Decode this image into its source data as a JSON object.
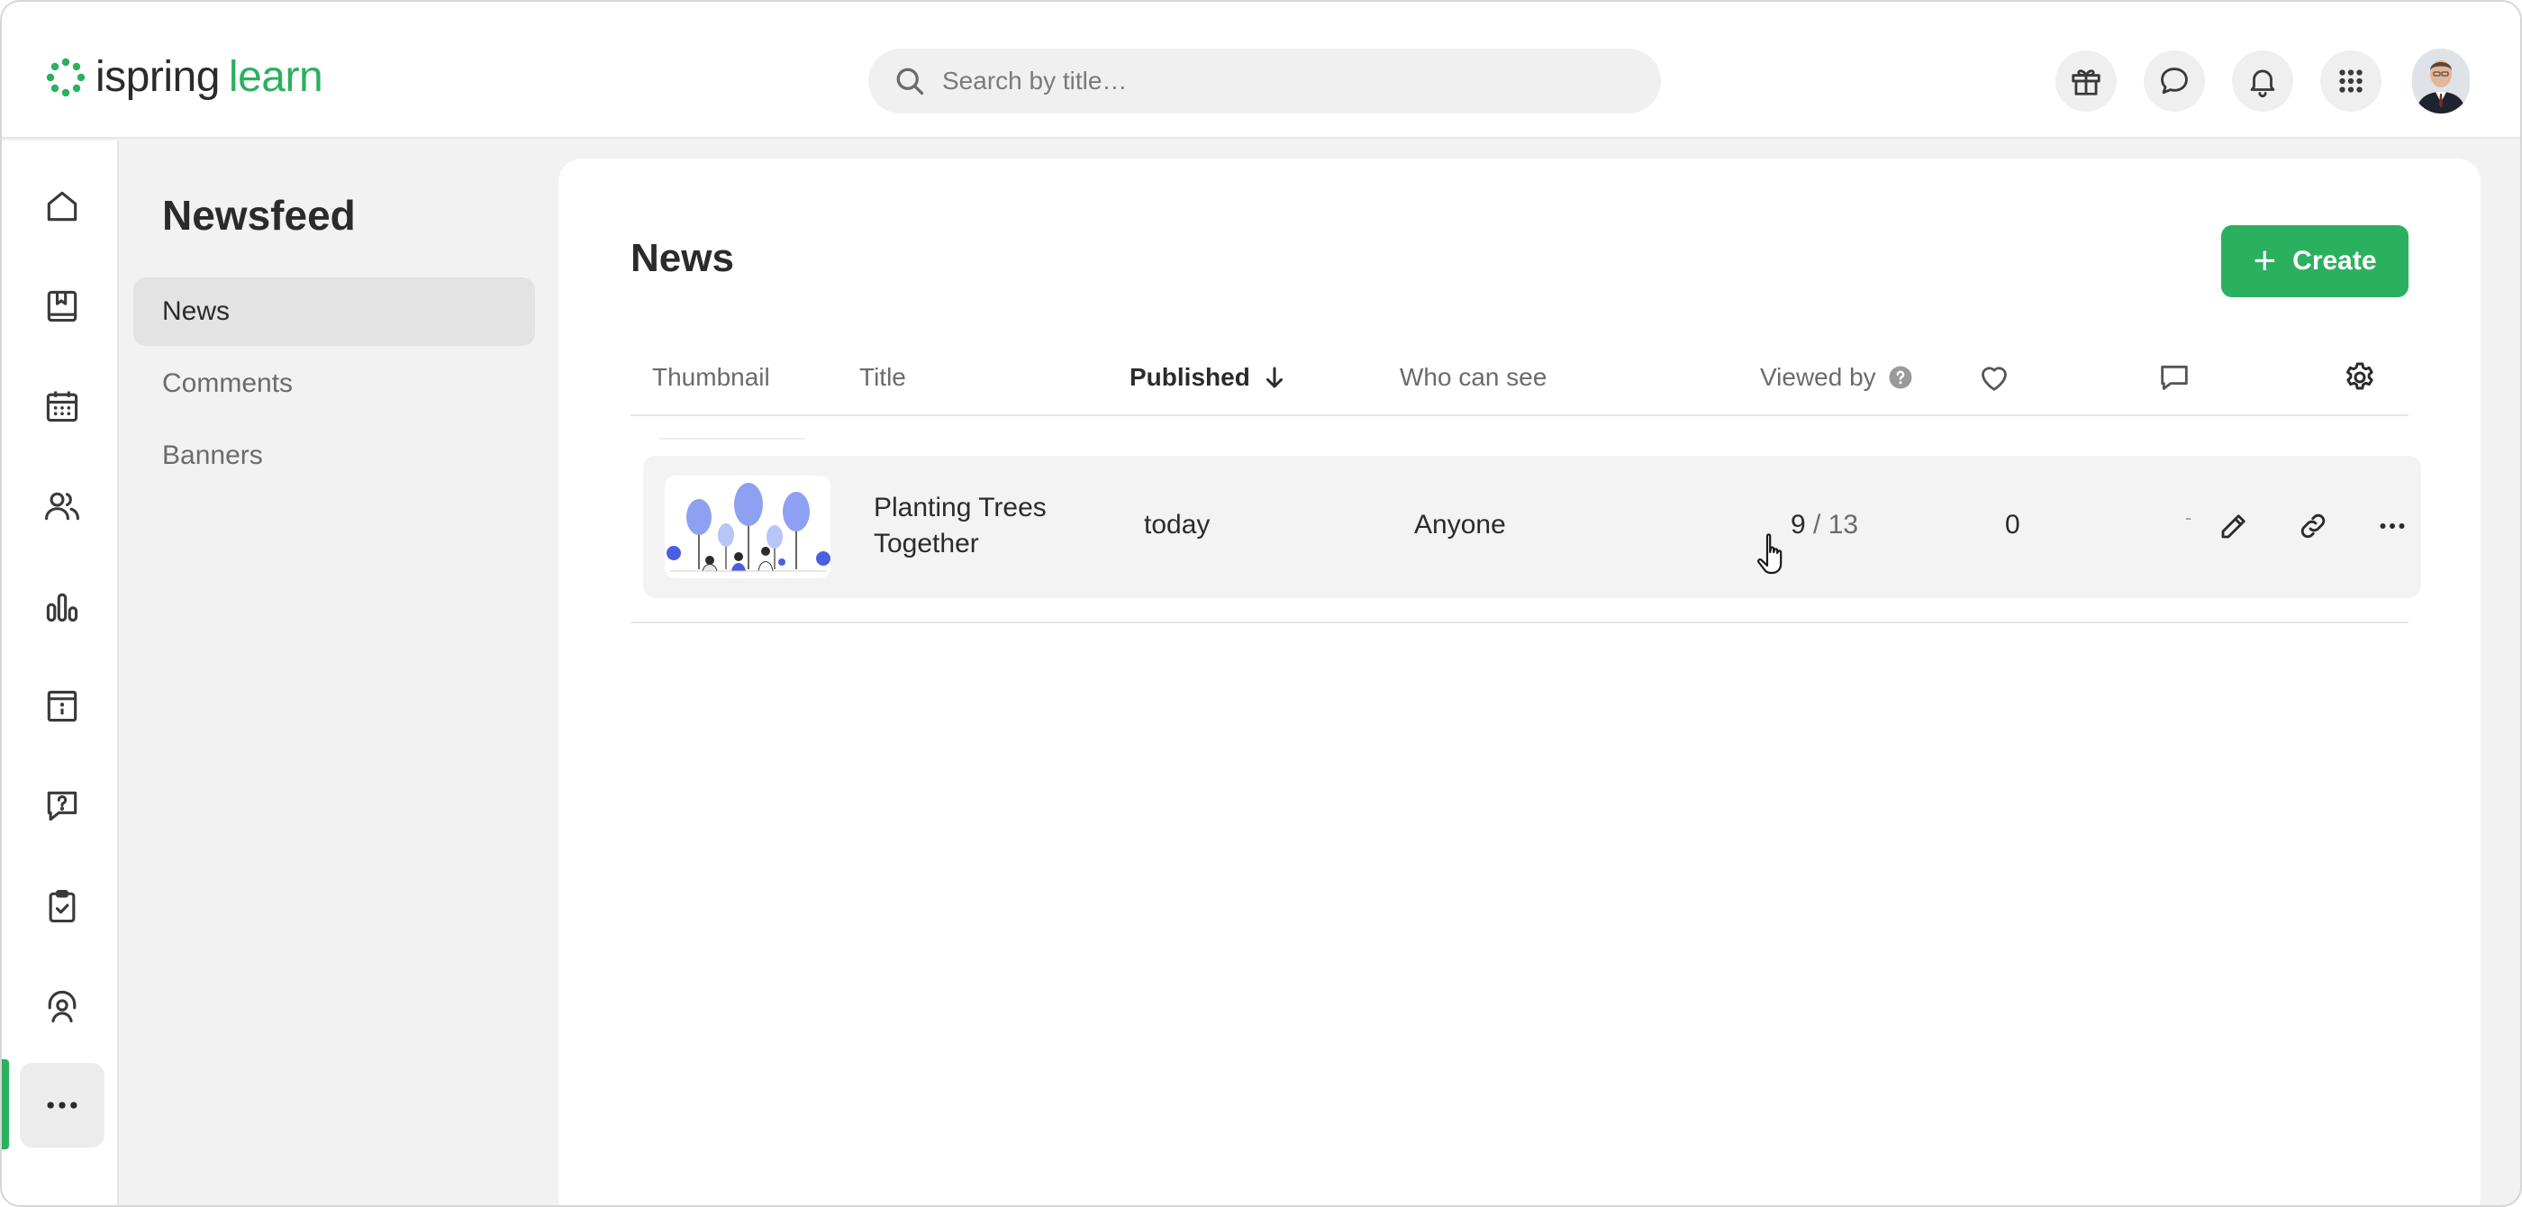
{
  "header": {
    "logo": {
      "part1": "ispring",
      "part2": "learn",
      "icon": "ispring-logo-icon"
    },
    "search": {
      "placeholder": "Search by title…",
      "value": ""
    },
    "icons": [
      "gift-icon",
      "chat-icon",
      "bell-icon",
      "apps-grid-icon"
    ],
    "avatar": "user-avatar"
  },
  "rail": {
    "items": [
      "home-icon",
      "book-icon",
      "calendar-icon",
      "users-icon",
      "chart-icon",
      "info-board-icon",
      "help-chat-icon",
      "clipboard-check-icon",
      "support-agent-icon",
      "more-icon"
    ],
    "active": "more-icon"
  },
  "subnav": {
    "title": "Newsfeed",
    "items": [
      {
        "label": "News",
        "active": true
      },
      {
        "label": "Comments",
        "active": false
      },
      {
        "label": "Banners",
        "active": false
      }
    ]
  },
  "main": {
    "title": "News",
    "create_label": "Create",
    "columns": {
      "thumbnail": "Thumbnail",
      "title": "Title",
      "published": "Published",
      "who_can_see": "Who can see",
      "viewed_by": "Viewed by",
      "likes_icon": "heart-icon",
      "comments_icon": "comment-icon",
      "settings_icon": "gear-icon"
    },
    "sort": {
      "column": "Published",
      "direction": "desc"
    },
    "rows": [
      {
        "thumbnail": "planting-trees-illustration",
        "title_line1": "Planting Trees",
        "title_line2": "Together",
        "published": "today",
        "who_can_see": "Anyone",
        "viewed": "9",
        "viewed_sep": " / ",
        "viewed_total": "13",
        "likes": "0",
        "comments": "-"
      }
    ]
  },
  "colors": {
    "brand_green": "#2bb05f",
    "accent_blue": "#5b6fe6",
    "text_dark": "#2b2b2b",
    "text_muted": "#6b6b6b"
  }
}
